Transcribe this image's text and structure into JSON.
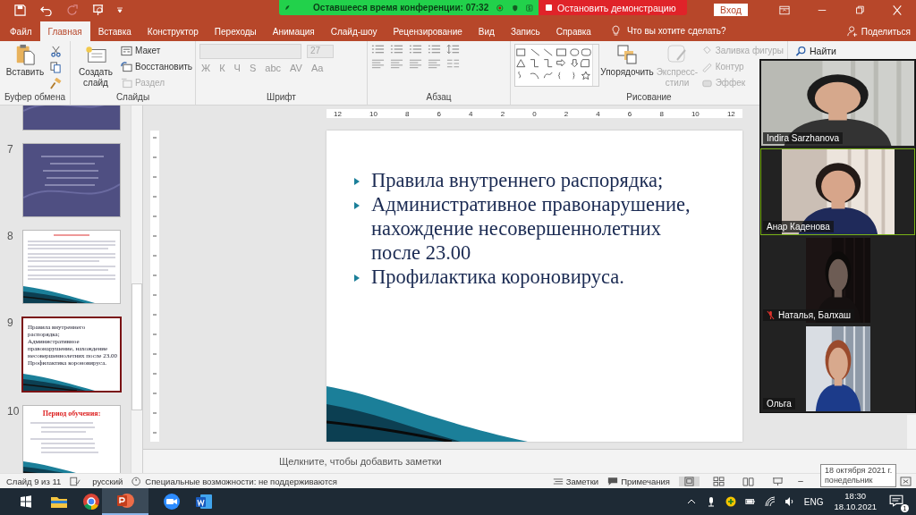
{
  "title_bar": {
    "conference_timer": "Оставшееся время конференции: 07:32",
    "stop_share_button": "Остановить демонстрацию",
    "sign_in_button": "Вход"
  },
  "tabs": [
    {
      "label": "Файл",
      "selected": false
    },
    {
      "label": "Главная",
      "selected": true
    },
    {
      "label": "Вставка",
      "selected": false
    },
    {
      "label": "Конструктор",
      "selected": false
    },
    {
      "label": "Переходы",
      "selected": false
    },
    {
      "label": "Анимация",
      "selected": false
    },
    {
      "label": "Слайд-шоу",
      "selected": false
    },
    {
      "label": "Рецензирование",
      "selected": false
    },
    {
      "label": "Вид",
      "selected": false
    },
    {
      "label": "Запись",
      "selected": false
    },
    {
      "label": "Справка",
      "selected": false
    }
  ],
  "tell_me": "Что вы хотите сделать?",
  "share_button": "Поделиться",
  "ribbon": {
    "clipboard": {
      "paste": "Вставить",
      "label": "Буфер обмена"
    },
    "slides": {
      "new_slide": "Создать слайд",
      "layout": "Макет",
      "reset": "Восстановить",
      "section": "Раздел",
      "label": "Слайды"
    },
    "font": {
      "size": "27",
      "buttons": [
        "Ж",
        "К",
        "Ч",
        "S",
        "abc",
        "AV",
        "Aa"
      ],
      "label": "Шрифт"
    },
    "paragraph": {
      "label": "Абзац"
    },
    "drawing": {
      "arrange": "Упорядочить",
      "quick_styles": "Экспресс-стили",
      "fill": "Заливка фигуры",
      "outline": "Контур",
      "effects": "Эффек",
      "label": "Рисование"
    },
    "find": "Найти"
  },
  "thumbnails": [
    {
      "kind": "dark",
      "selected": false
    },
    {
      "number": "7",
      "kind": "dark",
      "selected": false
    },
    {
      "number": "8",
      "kind": "text",
      "selected": false
    },
    {
      "number": "9",
      "kind": "bullets",
      "selected": true,
      "bullets": [
        "Правила внутреннего распорядка;",
        "Административное правонарушение, нахождение несовершеннолетних после 23.00",
        "Профилактика короновируса."
      ]
    },
    {
      "number": "10",
      "kind": "schedule",
      "selected": false,
      "title": "Период обучения:"
    }
  ],
  "ruler": [
    "12",
    "10",
    "8",
    "6",
    "4",
    "2",
    "0",
    "2",
    "4",
    "6",
    "8",
    "10",
    "12"
  ],
  "slide": {
    "bullets": [
      "Правила внутреннего распорядка;",
      "Административное правонарушение, нахождение несовершеннолетних после 23.00",
      "Профилактика короновируса."
    ]
  },
  "notes_placeholder": "Щелкните, чтобы добавить заметки",
  "participants": [
    {
      "name": "Indira Sarzhanova",
      "active_speaker": false,
      "muted": false
    },
    {
      "name": "Анар Каденова",
      "active_speaker": true,
      "muted": false
    },
    {
      "name": "Наталья, Балхаш",
      "active_speaker": false,
      "muted": true
    },
    {
      "name": "Ольга",
      "active_speaker": false,
      "muted": false
    }
  ],
  "status_bar": {
    "slide_counter": "Слайд 9 из 11",
    "language": "русский",
    "accessibility": "Специальные возможности: не поддерживаются",
    "notes_button": "Заметки",
    "comments_button": "Примечания"
  },
  "date_tooltip": [
    "18 октября 2021 г.",
    "понедельник"
  ],
  "taskbar": {
    "language": "ENG",
    "time": "18:30",
    "date": "18.10.2021",
    "notifications": "1"
  }
}
